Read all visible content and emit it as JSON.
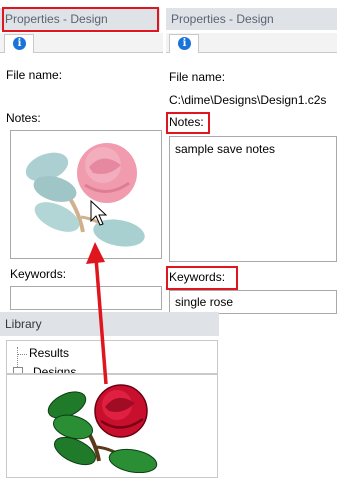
{
  "left_panel": {
    "title": "Properties - Design",
    "tab_icon": "info-icon",
    "file_name_label": "File name:",
    "notes_label": "Notes:",
    "keywords_label": "Keywords:",
    "preview_icon": "rose-design-preview"
  },
  "right_panel": {
    "title": "Properties - Design",
    "tab_icon": "info-icon",
    "file_name_label": "File name:",
    "file_name_value": "C:\\dime\\Designs\\Design1.c2s",
    "notes_label": "Notes:",
    "notes_value": "sample save notes",
    "keywords_label": "Keywords:",
    "keywords_value": "single rose"
  },
  "library": {
    "title": "Library",
    "tree_items": [
      "Results",
      "Designs"
    ],
    "preview_icon": "rose-design-preview"
  },
  "info_glyph": "i",
  "colors": {
    "highlight_red": "#e0161f",
    "info_blue": "#1a73d9",
    "titlebar_bg": "#dfe3e8"
  }
}
